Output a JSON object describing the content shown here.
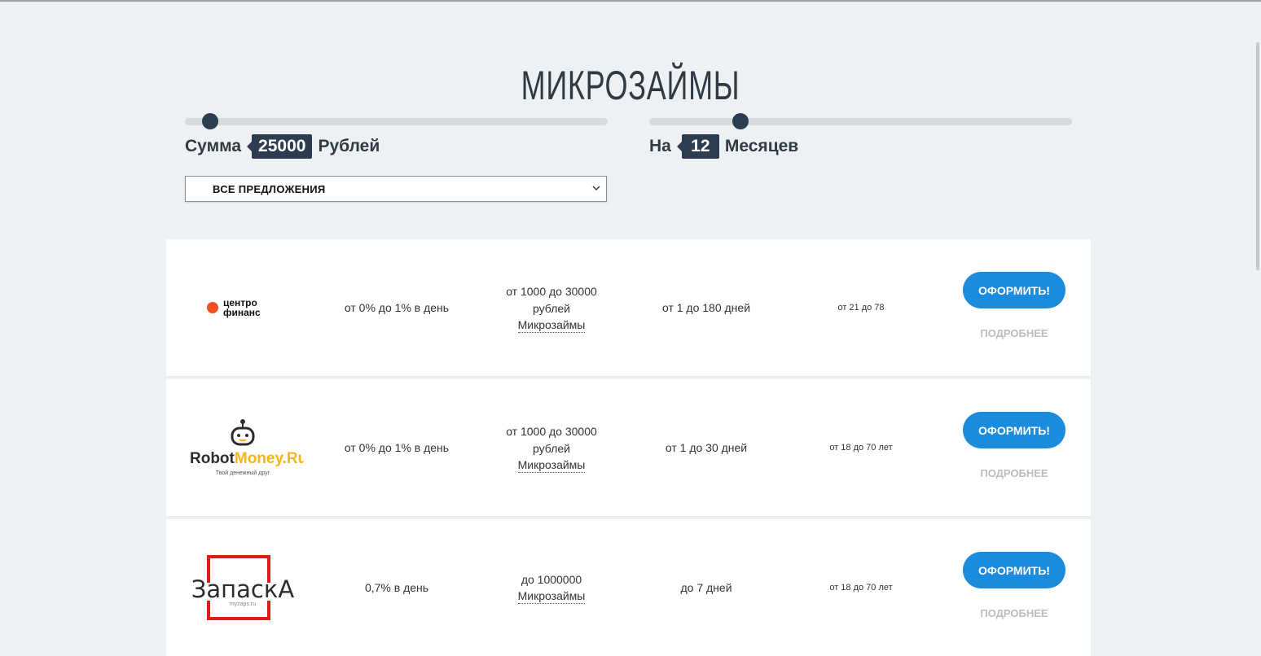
{
  "page": {
    "title": "МИКРОЗАЙМЫ"
  },
  "amount_slider": {
    "label_prefix": "Сумма",
    "value": "25000",
    "label_suffix": "Рублей",
    "level_fraction": 0.06
  },
  "term_slider": {
    "label_prefix": "На",
    "value": "12",
    "label_suffix": "Месяцев",
    "level_fraction": 0.215
  },
  "filter": {
    "selected": "ВСЕ ПРЕДЛОЖЕНИЯ"
  },
  "offers": [
    {
      "logo_text": "центро финанс",
      "logo_line1": "центро",
      "logo_line2": "финанс",
      "rate": "от 0% до 1% в день",
      "amount_line1": "от 1000 до 30000",
      "amount_line2": "рублей",
      "type": "Микрозаймы",
      "term": "от 1 до 180 дней",
      "age": "от 21 до 78",
      "apply_label": "ОФОРМИТЬ!",
      "details_label": "ПОДРОБНЕЕ"
    },
    {
      "logo_text": "RobotMoney.Ru Твой денежный друг",
      "logo_part1": "Robot",
      "logo_part2": "Money.Ru",
      "logo_tagline": "Твой денежный друг",
      "rate": "от 0% до 1% в день",
      "amount_line1": "от 1000 до 30000",
      "amount_line2": "рублей",
      "type": "Микрозаймы",
      "term": "от 1 до 30 дней",
      "age": "от 18 до 70 лет",
      "apply_label": "ОФОРМИТЬ!",
      "details_label": "ПОДРОБНЕЕ"
    },
    {
      "logo_text": "ЗапаскА myzaps.ru",
      "logo_word": "ЗапаскА",
      "logo_domain": "myzaps.ru",
      "rate": "0,7% в день",
      "amount_line1": "до 1000000",
      "amount_line2": "",
      "type": "Микрозаймы",
      "term": "до 7 дней",
      "age": "от 18 до 70 лет",
      "apply_label": "ОФОРМИТЬ!",
      "details_label": "ПОДРОБНЕЕ"
    }
  ],
  "colors": {
    "accent": "#1a8bdd",
    "dark": "#2c3d4f",
    "logo_orange": "#f04e23",
    "logo_red": "#e01b1b"
  }
}
